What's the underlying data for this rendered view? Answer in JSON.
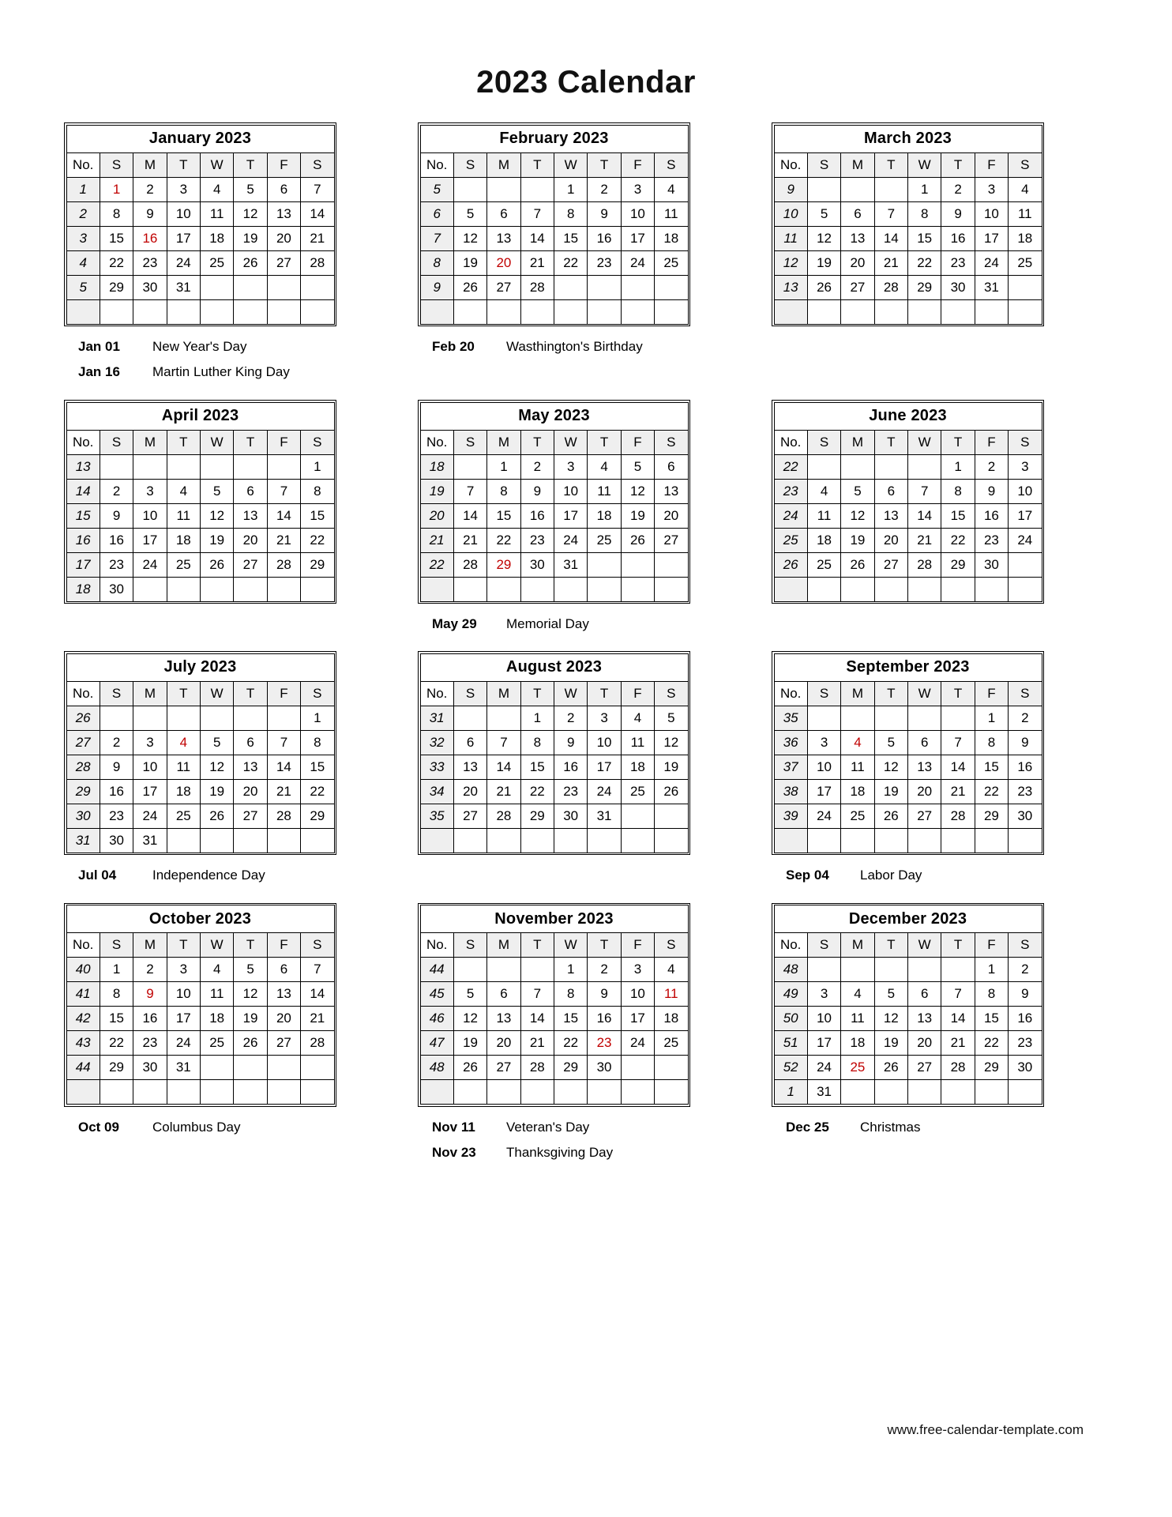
{
  "title": "2023 Calendar",
  "footer": "www.free-calendar-template.com",
  "accent_holiday_color": "#c00000",
  "week_header_label": "No.",
  "weekday_headers": [
    "S",
    "M",
    "T",
    "W",
    "T",
    "F",
    "S"
  ],
  "months": [
    {
      "name": "January 2023",
      "week_numbers": [
        "1",
        "2",
        "3",
        "4",
        "5",
        ""
      ],
      "weeks": [
        [
          "1",
          "2",
          "3",
          "4",
          "5",
          "6",
          "7"
        ],
        [
          "8",
          "9",
          "10",
          "11",
          "12",
          "13",
          "14"
        ],
        [
          "15",
          "16",
          "17",
          "18",
          "19",
          "20",
          "21"
        ],
        [
          "22",
          "23",
          "24",
          "25",
          "26",
          "27",
          "28"
        ],
        [
          "29",
          "30",
          "31",
          "",
          "",
          "",
          ""
        ],
        [
          "",
          "",
          "",
          "",
          "",
          "",
          ""
        ]
      ],
      "holiday_days": [
        "1",
        "16"
      ],
      "holidays": [
        {
          "date": "Jan 01",
          "name": "New Year's Day"
        },
        {
          "date": "Jan 16",
          "name": "Martin Luther King Day"
        }
      ]
    },
    {
      "name": "February 2023",
      "week_numbers": [
        "5",
        "6",
        "7",
        "8",
        "9",
        ""
      ],
      "weeks": [
        [
          "",
          "",
          "",
          "1",
          "2",
          "3",
          "4"
        ],
        [
          "5",
          "6",
          "7",
          "8",
          "9",
          "10",
          "11"
        ],
        [
          "12",
          "13",
          "14",
          "15",
          "16",
          "17",
          "18"
        ],
        [
          "19",
          "20",
          "21",
          "22",
          "23",
          "24",
          "25"
        ],
        [
          "26",
          "27",
          "28",
          "",
          "",
          "",
          ""
        ],
        [
          "",
          "",
          "",
          "",
          "",
          "",
          ""
        ]
      ],
      "holiday_days": [
        "20"
      ],
      "holidays": [
        {
          "date": "Feb 20",
          "name": "Wasthington's Birthday"
        }
      ]
    },
    {
      "name": "March 2023",
      "week_numbers": [
        "9",
        "10",
        "11",
        "12",
        "13",
        ""
      ],
      "weeks": [
        [
          "",
          "",
          "",
          "1",
          "2",
          "3",
          "4"
        ],
        [
          "5",
          "6",
          "7",
          "8",
          "9",
          "10",
          "11"
        ],
        [
          "12",
          "13",
          "14",
          "15",
          "16",
          "17",
          "18"
        ],
        [
          "19",
          "20",
          "21",
          "22",
          "23",
          "24",
          "25"
        ],
        [
          "26",
          "27",
          "28",
          "29",
          "30",
          "31",
          ""
        ],
        [
          "",
          "",
          "",
          "",
          "",
          "",
          ""
        ]
      ],
      "holiday_days": [],
      "holidays": []
    },
    {
      "name": "April 2023",
      "week_numbers": [
        "13",
        "14",
        "15",
        "16",
        "17",
        "18"
      ],
      "weeks": [
        [
          "",
          "",
          "",
          "",
          "",
          "",
          "1"
        ],
        [
          "2",
          "3",
          "4",
          "5",
          "6",
          "7",
          "8"
        ],
        [
          "9",
          "10",
          "11",
          "12",
          "13",
          "14",
          "15"
        ],
        [
          "16",
          "17",
          "18",
          "19",
          "20",
          "21",
          "22"
        ],
        [
          "23",
          "24",
          "25",
          "26",
          "27",
          "28",
          "29"
        ],
        [
          "30",
          "",
          "",
          "",
          "",
          "",
          ""
        ]
      ],
      "holiday_days": [],
      "holidays": []
    },
    {
      "name": "May 2023",
      "week_numbers": [
        "18",
        "19",
        "20",
        "21",
        "22",
        ""
      ],
      "weeks": [
        [
          "",
          "1",
          "2",
          "3",
          "4",
          "5",
          "6"
        ],
        [
          "7",
          "8",
          "9",
          "10",
          "11",
          "12",
          "13"
        ],
        [
          "14",
          "15",
          "16",
          "17",
          "18",
          "19",
          "20"
        ],
        [
          "21",
          "22",
          "23",
          "24",
          "25",
          "26",
          "27"
        ],
        [
          "28",
          "29",
          "30",
          "31",
          "",
          "",
          ""
        ],
        [
          "",
          "",
          "",
          "",
          "",
          "",
          ""
        ]
      ],
      "holiday_days": [
        "29"
      ],
      "holidays": [
        {
          "date": "May 29",
          "name": "Memorial Day"
        }
      ]
    },
    {
      "name": "June 2023",
      "week_numbers": [
        "22",
        "23",
        "24",
        "25",
        "26",
        ""
      ],
      "weeks": [
        [
          "",
          "",
          "",
          "",
          "1",
          "2",
          "3"
        ],
        [
          "4",
          "5",
          "6",
          "7",
          "8",
          "9",
          "10"
        ],
        [
          "11",
          "12",
          "13",
          "14",
          "15",
          "16",
          "17"
        ],
        [
          "18",
          "19",
          "20",
          "21",
          "22",
          "23",
          "24"
        ],
        [
          "25",
          "26",
          "27",
          "28",
          "29",
          "30",
          ""
        ],
        [
          "",
          "",
          "",
          "",
          "",
          "",
          ""
        ]
      ],
      "holiday_days": [],
      "holidays": []
    },
    {
      "name": "July 2023",
      "week_numbers": [
        "26",
        "27",
        "28",
        "29",
        "30",
        "31"
      ],
      "weeks": [
        [
          "",
          "",
          "",
          "",
          "",
          "",
          "1"
        ],
        [
          "2",
          "3",
          "4",
          "5",
          "6",
          "7",
          "8"
        ],
        [
          "9",
          "10",
          "11",
          "12",
          "13",
          "14",
          "15"
        ],
        [
          "16",
          "17",
          "18",
          "19",
          "20",
          "21",
          "22"
        ],
        [
          "23",
          "24",
          "25",
          "26",
          "27",
          "28",
          "29"
        ],
        [
          "30",
          "31",
          "",
          "",
          "",
          "",
          ""
        ]
      ],
      "holiday_days": [
        "4"
      ],
      "holidays": [
        {
          "date": "Jul 04",
          "name": "Independence Day"
        }
      ]
    },
    {
      "name": "August 2023",
      "week_numbers": [
        "31",
        "32",
        "33",
        "34",
        "35",
        ""
      ],
      "weeks": [
        [
          "",
          "",
          "1",
          "2",
          "3",
          "4",
          "5"
        ],
        [
          "6",
          "7",
          "8",
          "9",
          "10",
          "11",
          "12"
        ],
        [
          "13",
          "14",
          "15",
          "16",
          "17",
          "18",
          "19"
        ],
        [
          "20",
          "21",
          "22",
          "23",
          "24",
          "25",
          "26"
        ],
        [
          "27",
          "28",
          "29",
          "30",
          "31",
          "",
          ""
        ],
        [
          "",
          "",
          "",
          "",
          "",
          "",
          ""
        ]
      ],
      "holiday_days": [],
      "holidays": []
    },
    {
      "name": "September 2023",
      "week_numbers": [
        "35",
        "36",
        "37",
        "38",
        "39",
        ""
      ],
      "weeks": [
        [
          "",
          "",
          "",
          "",
          "",
          "1",
          "2"
        ],
        [
          "3",
          "4",
          "5",
          "6",
          "7",
          "8",
          "9"
        ],
        [
          "10",
          "11",
          "12",
          "13",
          "14",
          "15",
          "16"
        ],
        [
          "17",
          "18",
          "19",
          "20",
          "21",
          "22",
          "23"
        ],
        [
          "24",
          "25",
          "26",
          "27",
          "28",
          "29",
          "30"
        ],
        [
          "",
          "",
          "",
          "",
          "",
          "",
          ""
        ]
      ],
      "holiday_days": [
        "4"
      ],
      "holidays": [
        {
          "date": "Sep 04",
          "name": "Labor Day"
        }
      ]
    },
    {
      "name": "October 2023",
      "week_numbers": [
        "40",
        "41",
        "42",
        "43",
        "44",
        ""
      ],
      "weeks": [
        [
          "1",
          "2",
          "3",
          "4",
          "5",
          "6",
          "7"
        ],
        [
          "8",
          "9",
          "10",
          "11",
          "12",
          "13",
          "14"
        ],
        [
          "15",
          "16",
          "17",
          "18",
          "19",
          "20",
          "21"
        ],
        [
          "22",
          "23",
          "24",
          "25",
          "26",
          "27",
          "28"
        ],
        [
          "29",
          "30",
          "31",
          "",
          "",
          "",
          ""
        ],
        [
          "",
          "",
          "",
          "",
          "",
          "",
          ""
        ]
      ],
      "holiday_days": [
        "9"
      ],
      "holidays": [
        {
          "date": "Oct 09",
          "name": "Columbus Day"
        }
      ]
    },
    {
      "name": "November 2023",
      "week_numbers": [
        "44",
        "45",
        "46",
        "47",
        "48",
        ""
      ],
      "weeks": [
        [
          "",
          "",
          "",
          "1",
          "2",
          "3",
          "4"
        ],
        [
          "5",
          "6",
          "7",
          "8",
          "9",
          "10",
          "11"
        ],
        [
          "12",
          "13",
          "14",
          "15",
          "16",
          "17",
          "18"
        ],
        [
          "19",
          "20",
          "21",
          "22",
          "23",
          "24",
          "25"
        ],
        [
          "26",
          "27",
          "28",
          "29",
          "30",
          "",
          ""
        ],
        [
          "",
          "",
          "",
          "",
          "",
          "",
          ""
        ]
      ],
      "holiday_days": [
        "11",
        "23"
      ],
      "holidays": [
        {
          "date": "Nov 11",
          "name": "Veteran's Day"
        },
        {
          "date": "Nov 23",
          "name": "Thanksgiving Day"
        }
      ]
    },
    {
      "name": "December 2023",
      "week_numbers": [
        "48",
        "49",
        "50",
        "51",
        "52",
        "1"
      ],
      "weeks": [
        [
          "",
          "",
          "",
          "",
          "",
          "1",
          "2"
        ],
        [
          "3",
          "4",
          "5",
          "6",
          "7",
          "8",
          "9"
        ],
        [
          "10",
          "11",
          "12",
          "13",
          "14",
          "15",
          "16"
        ],
        [
          "17",
          "18",
          "19",
          "20",
          "21",
          "22",
          "23"
        ],
        [
          "24",
          "25",
          "26",
          "27",
          "28",
          "29",
          "30"
        ],
        [
          "31",
          "",
          "",
          "",
          "",
          "",
          ""
        ]
      ],
      "holiday_days": [
        "25"
      ],
      "holidays": [
        {
          "date": "Dec 25",
          "name": "Christmas"
        }
      ]
    }
  ]
}
